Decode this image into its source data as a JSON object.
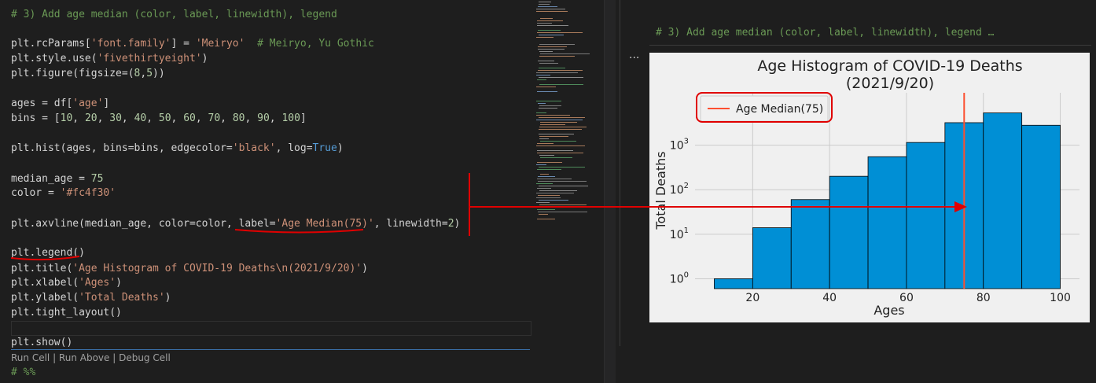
{
  "editor": {
    "lines": [
      {
        "top": 10,
        "segments": [
          {
            "cls": "cm",
            "text": "# 3) Add age median (color, label, linewidth), legend"
          }
        ]
      },
      {
        "top": 47,
        "segments": [
          {
            "cls": "",
            "text": "plt.rcParams["
          },
          {
            "cls": "st",
            "text": "'font.family'"
          },
          {
            "cls": "",
            "text": "] = "
          },
          {
            "cls": "st",
            "text": "'Meiryo'"
          },
          {
            "cls": "",
            "text": "  "
          },
          {
            "cls": "cm",
            "text": "# Meiryo, Yu Gothic"
          }
        ]
      },
      {
        "top": 66,
        "segments": [
          {
            "cls": "",
            "text": "plt.style.use("
          },
          {
            "cls": "st",
            "text": "'fivethirtyeight'"
          },
          {
            "cls": "",
            "text": ")"
          }
        ]
      },
      {
        "top": 85,
        "segments": [
          {
            "cls": "",
            "text": "plt.figure(figsize=("
          },
          {
            "cls": "nb",
            "text": "8"
          },
          {
            "cls": "",
            "text": ","
          },
          {
            "cls": "nb",
            "text": "5"
          },
          {
            "cls": "",
            "text": "))"
          }
        ]
      },
      {
        "top": 123,
        "segments": [
          {
            "cls": "",
            "text": "ages = df["
          },
          {
            "cls": "st",
            "text": "'age'"
          },
          {
            "cls": "",
            "text": "]"
          }
        ]
      },
      {
        "top": 142,
        "segments": [
          {
            "cls": "",
            "text": "bins = ["
          },
          {
            "cls": "nb",
            "text": "10"
          },
          {
            "cls": "",
            "text": ", "
          },
          {
            "cls": "nb",
            "text": "20"
          },
          {
            "cls": "",
            "text": ", "
          },
          {
            "cls": "nb",
            "text": "30"
          },
          {
            "cls": "",
            "text": ", "
          },
          {
            "cls": "nb",
            "text": "40"
          },
          {
            "cls": "",
            "text": ", "
          },
          {
            "cls": "nb",
            "text": "50"
          },
          {
            "cls": "",
            "text": ", "
          },
          {
            "cls": "nb",
            "text": "60"
          },
          {
            "cls": "",
            "text": ", "
          },
          {
            "cls": "nb",
            "text": "70"
          },
          {
            "cls": "",
            "text": ", "
          },
          {
            "cls": "nb",
            "text": "80"
          },
          {
            "cls": "",
            "text": ", "
          },
          {
            "cls": "nb",
            "text": "90"
          },
          {
            "cls": "",
            "text": ", "
          },
          {
            "cls": "nb",
            "text": "100"
          },
          {
            "cls": "",
            "text": "]"
          }
        ]
      },
      {
        "top": 180,
        "segments": [
          {
            "cls": "",
            "text": "plt.hist(ages, bins=bins, edgecolor="
          },
          {
            "cls": "st",
            "text": "'black'"
          },
          {
            "cls": "",
            "text": ", log="
          },
          {
            "cls": "kw",
            "text": "True"
          },
          {
            "cls": "",
            "text": ")"
          }
        ]
      },
      {
        "top": 219,
        "segments": [
          {
            "cls": "",
            "text": "median_age = "
          },
          {
            "cls": "nb",
            "text": "75"
          }
        ]
      },
      {
        "top": 237,
        "segments": [
          {
            "cls": "",
            "text": "color = "
          },
          {
            "cls": "st",
            "text": "'#fc4f30'"
          }
        ]
      },
      {
        "top": 276,
        "segments": [
          {
            "cls": "",
            "text": "plt.axvline(median_age, color=color, label="
          },
          {
            "cls": "st",
            "text": "'Age Median(75)'"
          },
          {
            "cls": "",
            "text": ", linewidth="
          },
          {
            "cls": "nb",
            "text": "2"
          },
          {
            "cls": "",
            "text": ")"
          }
        ]
      },
      {
        "top": 313,
        "segments": [
          {
            "cls": "",
            "text": "plt.legend()"
          }
        ]
      },
      {
        "top": 333,
        "segments": [
          {
            "cls": "",
            "text": "plt.title("
          },
          {
            "cls": "st",
            "text": "'Age Histogram of COVID-19 Deaths\\n(2021/9/20)'"
          },
          {
            "cls": "",
            "text": ")"
          }
        ]
      },
      {
        "top": 351,
        "segments": [
          {
            "cls": "",
            "text": "plt.xlabel("
          },
          {
            "cls": "st",
            "text": "'Ages'"
          },
          {
            "cls": "",
            "text": ")"
          }
        ]
      },
      {
        "top": 370,
        "segments": [
          {
            "cls": "",
            "text": "plt.ylabel("
          },
          {
            "cls": "st",
            "text": "'Total Deaths'"
          },
          {
            "cls": "",
            "text": ")"
          }
        ]
      },
      {
        "top": 389,
        "segments": [
          {
            "cls": "",
            "text": "plt.tight_layout()"
          }
        ]
      },
      {
        "top": 427,
        "segments": [
          {
            "cls": "",
            "text": "plt.show()"
          }
        ]
      }
    ],
    "codelens": "Run Cell | Run Above | Debug Cell",
    "next_cell": "# %%"
  },
  "output": {
    "header": "# 3) Add age median (color, label, linewidth), legend …",
    "ellipsis": "..."
  },
  "chart_data": {
    "type": "bar",
    "title": "Age Histogram of COVID-19 Deaths\n(2021/9/20)",
    "xlabel": "Ages",
    "ylabel": "Total Deaths",
    "yscale": "log",
    "bins": [
      10,
      20,
      30,
      40,
      50,
      60,
      70,
      80,
      90,
      100
    ],
    "values": [
      1,
      14,
      60,
      200,
      550,
      1150,
      3200,
      5300,
      2800
    ],
    "xlim": [
      5,
      105
    ],
    "ylim": [
      0.6,
      15000
    ],
    "xticks": [
      20,
      40,
      60,
      80,
      100
    ],
    "yticks": [
      1,
      10,
      100,
      1000
    ],
    "ytick_labels": [
      [
        "10",
        "0"
      ],
      [
        "10",
        "1"
      ],
      [
        "10",
        "2"
      ],
      [
        "10",
        "3"
      ]
    ],
    "bar_color": "#008fd5",
    "edge_color": "#000000",
    "median": {
      "value": 75,
      "label": "Age Median(75)",
      "color": "#fc4f30"
    },
    "legend": "top-left",
    "grid": true
  },
  "annotation_color": "#e00000"
}
